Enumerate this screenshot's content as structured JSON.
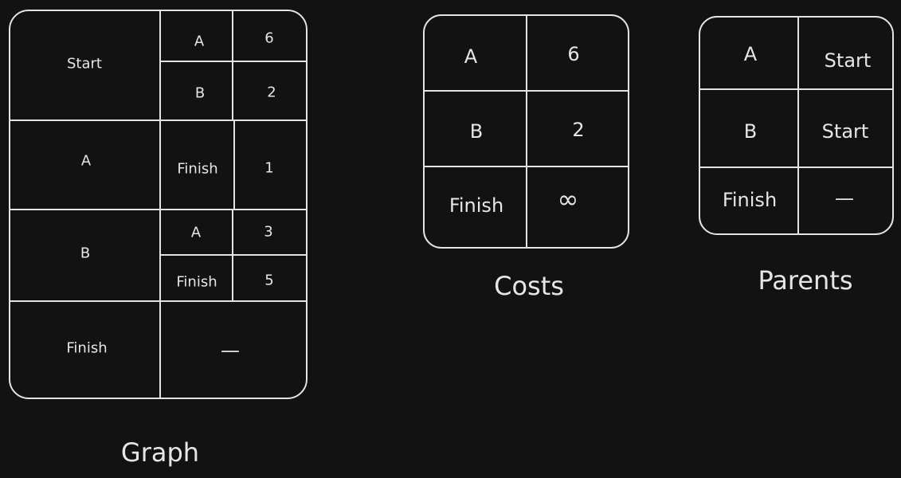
{
  "graph": {
    "title": "Graph",
    "rows": [
      {
        "node": "Start",
        "neighbors": [
          {
            "node": "A",
            "weight": "6"
          },
          {
            "node": "B",
            "weight": "2"
          }
        ]
      },
      {
        "node": "A",
        "neighbors": [
          {
            "node": "Finish",
            "weight": "1"
          }
        ]
      },
      {
        "node": "B",
        "neighbors": [
          {
            "node": "A",
            "weight": "3"
          },
          {
            "node": "Finish",
            "weight": "5"
          }
        ]
      },
      {
        "node": "Finish",
        "empty_marker": "—"
      }
    ]
  },
  "costs": {
    "title": "Costs",
    "rows": [
      {
        "node": "A",
        "value": "6"
      },
      {
        "node": "B",
        "value": "2"
      },
      {
        "node": "Finish",
        "value": "∞"
      }
    ]
  },
  "parents": {
    "title": "Parents",
    "rows": [
      {
        "node": "A",
        "parent": "Start"
      },
      {
        "node": "B",
        "parent": "Start"
      },
      {
        "node": "Finish",
        "parent": "—"
      }
    ]
  }
}
